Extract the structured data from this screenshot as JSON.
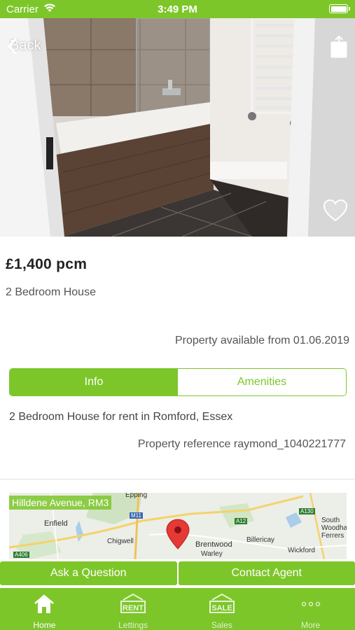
{
  "status_bar": {
    "carrier": "Carrier",
    "time": "3:49 PM"
  },
  "header": {
    "back_label": "Back"
  },
  "listing": {
    "price": "£1,400 pcm",
    "type": "2 Bedroom House",
    "available": "Property available from 01.06.2019",
    "description": "2 Bedroom House for rent in Romford, Essex",
    "reference": "Property reference raymond_1040221777"
  },
  "tabs_segment": {
    "info": "Info",
    "amenities": "Amenities",
    "selected": "Info"
  },
  "map": {
    "location_label": "Hilldene Avenue, RM3",
    "places": [
      "Enfield",
      "Chigwell",
      "Brentwood",
      "Warley",
      "Billericay",
      "Wickford",
      "South Woodham Ferrers",
      "Epping"
    ],
    "roads": [
      "M11",
      "A12",
      "A130",
      "A406"
    ]
  },
  "actions": {
    "ask": "Ask a Question",
    "contact": "Contact Agent"
  },
  "tab_bar": {
    "items": [
      {
        "label": "Home",
        "icon": "home-icon",
        "active": true
      },
      {
        "label": "Lettings",
        "icon": "rent-sign-icon",
        "badge": "RENT",
        "active": false
      },
      {
        "label": "Sales",
        "icon": "sale-sign-icon",
        "badge": "SALE",
        "active": false
      },
      {
        "label": "More",
        "icon": "more-dots-icon",
        "active": false
      }
    ]
  },
  "colors": {
    "brand": "#7dc62a",
    "text": "#444444",
    "map_pin": "#e53935"
  }
}
